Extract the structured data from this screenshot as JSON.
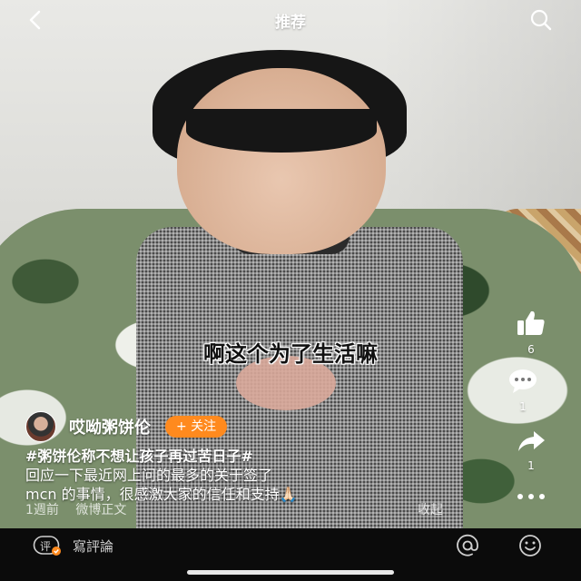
{
  "header": {
    "title": "推荐"
  },
  "video": {
    "subtitle": "啊这个为了生活嘛"
  },
  "actions": {
    "like_count": "6",
    "comment_count": "1",
    "share_count": "1"
  },
  "author": {
    "name": "哎呦粥饼伦",
    "follow_label": "+ 关注"
  },
  "caption": {
    "hashtag": "#粥饼伦称不想让孩子再过苦日子#",
    "line2": "回应一下最近网上问的最多的关于签了",
    "line3": "mcn 的事情，很感激大家的信任和支持🙏🏻"
  },
  "meta": {
    "time": "1週前",
    "source": "微博正文",
    "collapse_label": "收起"
  },
  "comment_bar": {
    "badge": "评",
    "placeholder": "寫評論"
  },
  "colors": {
    "follow_bg": "#ff8a1e",
    "bottom_bar": "#0b0b0b"
  }
}
